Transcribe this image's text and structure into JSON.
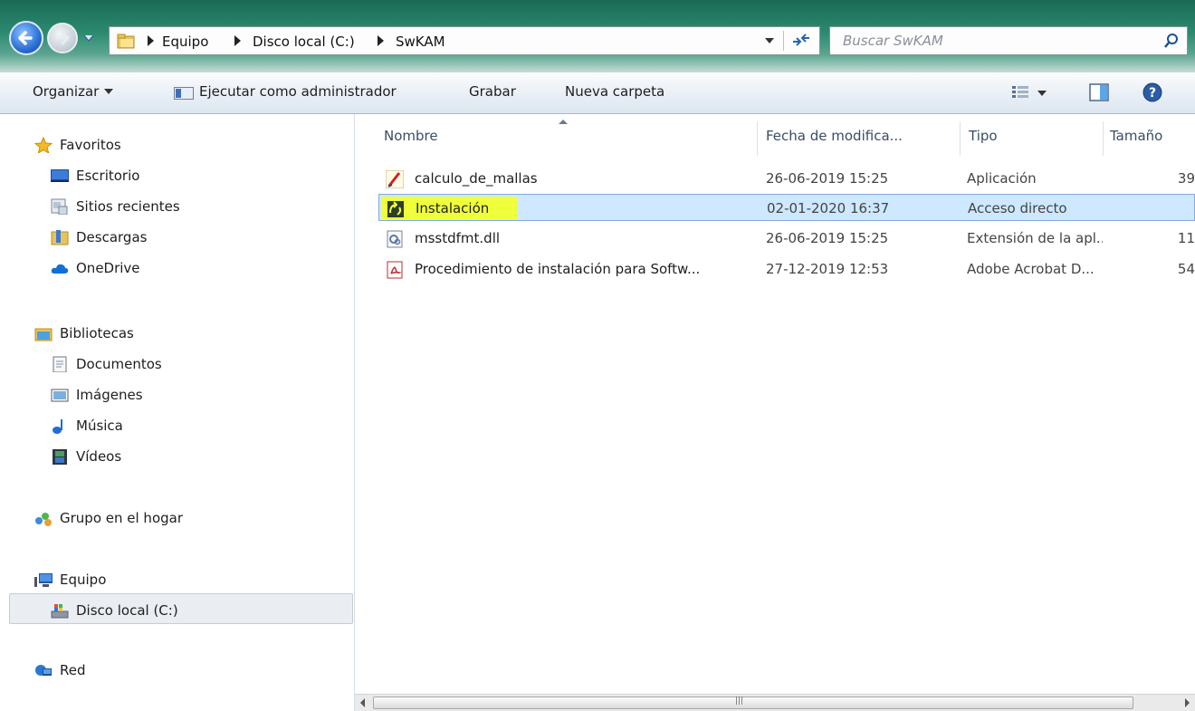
{
  "address_bar": {
    "crumbs": [
      "Equipo",
      "Disco local (C:)",
      "SwKAM"
    ],
    "search_placeholder": "Buscar SwKAM"
  },
  "toolbar": {
    "organize": "Organizar",
    "run_as_admin": "Ejecutar como administrador",
    "burn": "Grabar",
    "new_folder": "Nueva carpeta"
  },
  "nav": {
    "favorites": "Favoritos",
    "desktop": "Escritorio",
    "recent": "Sitios recientes",
    "downloads": "Descargas",
    "onedrive": "OneDrive",
    "libraries": "Bibliotecas",
    "documents": "Documentos",
    "pictures": "Imágenes",
    "music": "Música",
    "videos": "Vídeos",
    "homegroup": "Grupo en el hogar",
    "computer": "Equipo",
    "local_disk": "Disco local (C:)",
    "network": "Red"
  },
  "columns": {
    "name": "Nombre",
    "date": "Fecha de modifica...",
    "type": "Tipo",
    "size": "Tamaño"
  },
  "files": [
    {
      "name": "calculo_de_mallas",
      "date": "26-06-2019 15:25",
      "type": "Aplicación",
      "size": "39",
      "icon": "application-icon"
    },
    {
      "name": "Instalación",
      "date": "02-01-2020 16:37",
      "type": "Acceso directo",
      "size": "",
      "icon": "shortcut-icon",
      "selected": true,
      "highlighted": true
    },
    {
      "name": "msstdfmt.dll",
      "date": "26-06-2019 15:25",
      "type": "Extensión de la apl...",
      "size": "11",
      "icon": "dll-icon"
    },
    {
      "name": "Procedimiento de instalación para Softw...",
      "date": "27-12-2019 12:53",
      "type": "Adobe Acrobat D...",
      "size": "54",
      "icon": "pdf-icon"
    }
  ],
  "colors": {
    "selection_bg": "#cde8ff",
    "highlighter": "#f0ff3c",
    "address_bar": "#2c8a70"
  }
}
